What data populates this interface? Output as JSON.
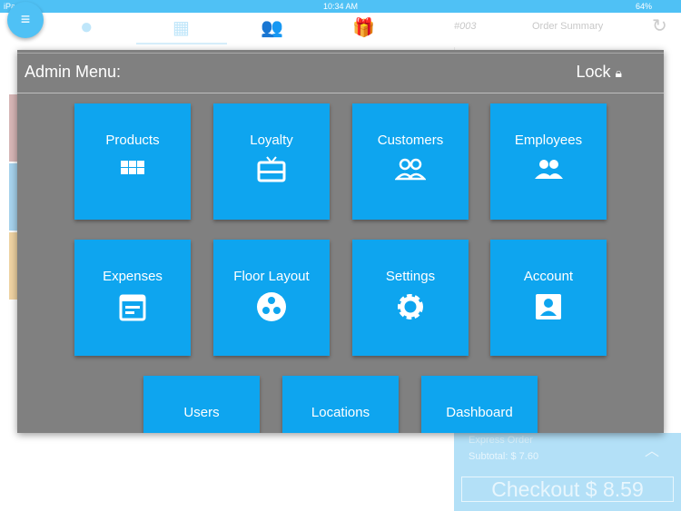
{
  "status": {
    "device": "iPad",
    "time": "10:34 AM",
    "battery": "64%"
  },
  "header": {
    "order_number": "#003",
    "order_summary": "Order Summary"
  },
  "footer": {
    "express": "Express Order",
    "subtotal": "Subtotal: $ 7.60",
    "checkout": "Checkout $ 8.59"
  },
  "dialog": {
    "title": "Admin Menu:",
    "lock": "Lock",
    "tiles": [
      {
        "label": "Products",
        "icon": "grid-icon"
      },
      {
        "label": "Loyalty",
        "icon": "gift-card-icon"
      },
      {
        "label": "Customers",
        "icon": "people-outline-icon"
      },
      {
        "label": "Employees",
        "icon": "people-icon"
      },
      {
        "label": "Expenses",
        "icon": "calendar-note-icon"
      },
      {
        "label": "Floor Layout",
        "icon": "floor-layout-icon"
      },
      {
        "label": "Settings",
        "icon": "gear-icon"
      },
      {
        "label": "Account",
        "icon": "account-box-icon"
      },
      {
        "label": "Users",
        "icon": "user-icon"
      },
      {
        "label": "Locations",
        "icon": "location-icon"
      },
      {
        "label": "Dashboard",
        "icon": "dashboard-icon"
      }
    ]
  },
  "colors": {
    "tile": "#0ea5ef",
    "overlay": "#808080",
    "accent": "#4fc1f5"
  }
}
